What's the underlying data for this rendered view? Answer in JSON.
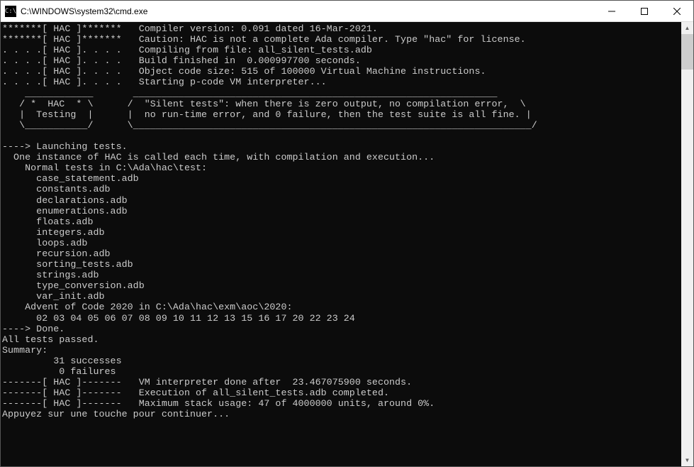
{
  "titlebar": {
    "icon_text": "C:\\",
    "title": "C:\\WINDOWS\\system32\\cmd.exe"
  },
  "console": {
    "lines": [
      "*******[ HAC ]*******   Compiler version: 0.091 dated 16-Mar-2021.",
      "*******[ HAC ]*******   Caution: HAC is not a complete Ada compiler. Type \"hac\" for license.",
      ". . . .[ HAC ]. . . .   Compiling from file: all_silent_tests.adb",
      ". . . .[ HAC ]. . . .   Build finished in  0.000997700 seconds.",
      ". . . .[ HAC ]. . . .   Object code size: 515 of 100000 Virtual Machine instructions.",
      ". . . .[ HAC ]. . . .   Starting p-code VM interpreter...",
      "    ____________       ________________________________________________________________",
      "   / *  HAC  * \\      /  \"Silent tests\": when there is zero output, no compilation error,  \\",
      "   |  Testing  |      |  no run-time error, and 0 failure, then the test suite is all fine. |",
      "   \\___________/      \\______________________________________________________________________/",
      "",
      "----> Launching tests.",
      "  One instance of HAC is called each time, with compilation and execution...",
      "    Normal tests in C:\\Ada\\hac\\test:",
      "      case_statement.adb",
      "      constants.adb",
      "      declarations.adb",
      "      enumerations.adb",
      "      floats.adb",
      "      integers.adb",
      "      loops.adb",
      "      recursion.adb",
      "      sorting_tests.adb",
      "      strings.adb",
      "      type_conversion.adb",
      "      var_init.adb",
      "    Advent of Code 2020 in C:\\Ada\\hac\\exm\\aoc\\2020:",
      "      02 03 04 05 06 07 08 09 10 11 12 13 15 16 17 20 22 23 24",
      "----> Done.",
      "All tests passed.",
      "Summary:",
      "         31 successes",
      "          0 failures",
      "-------[ HAC ]-------   VM interpreter done after  23.467075900 seconds.",
      "-------[ HAC ]-------   Execution of all_silent_tests.adb completed.",
      "-------[ HAC ]-------   Maximum stack usage: 47 of 4000000 units, around 0%.",
      "Appuyez sur une touche pour continuer..."
    ]
  }
}
